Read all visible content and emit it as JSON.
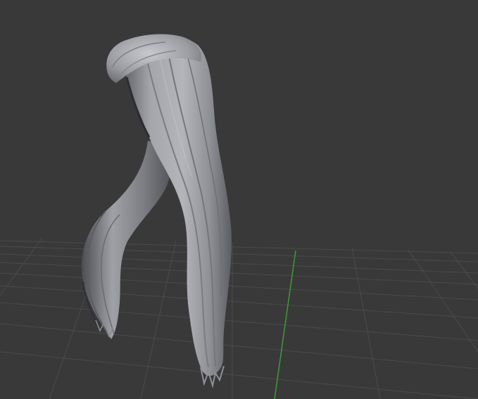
{
  "viewport": {
    "background_color": "#393939",
    "grid_color": "#4a4a4a",
    "y_axis_color": "#3f9a3a",
    "model_base_color": "#8c8e94",
    "model_highlight_color": "#c9cbd0",
    "model_shadow_color": "#2e2f33"
  }
}
